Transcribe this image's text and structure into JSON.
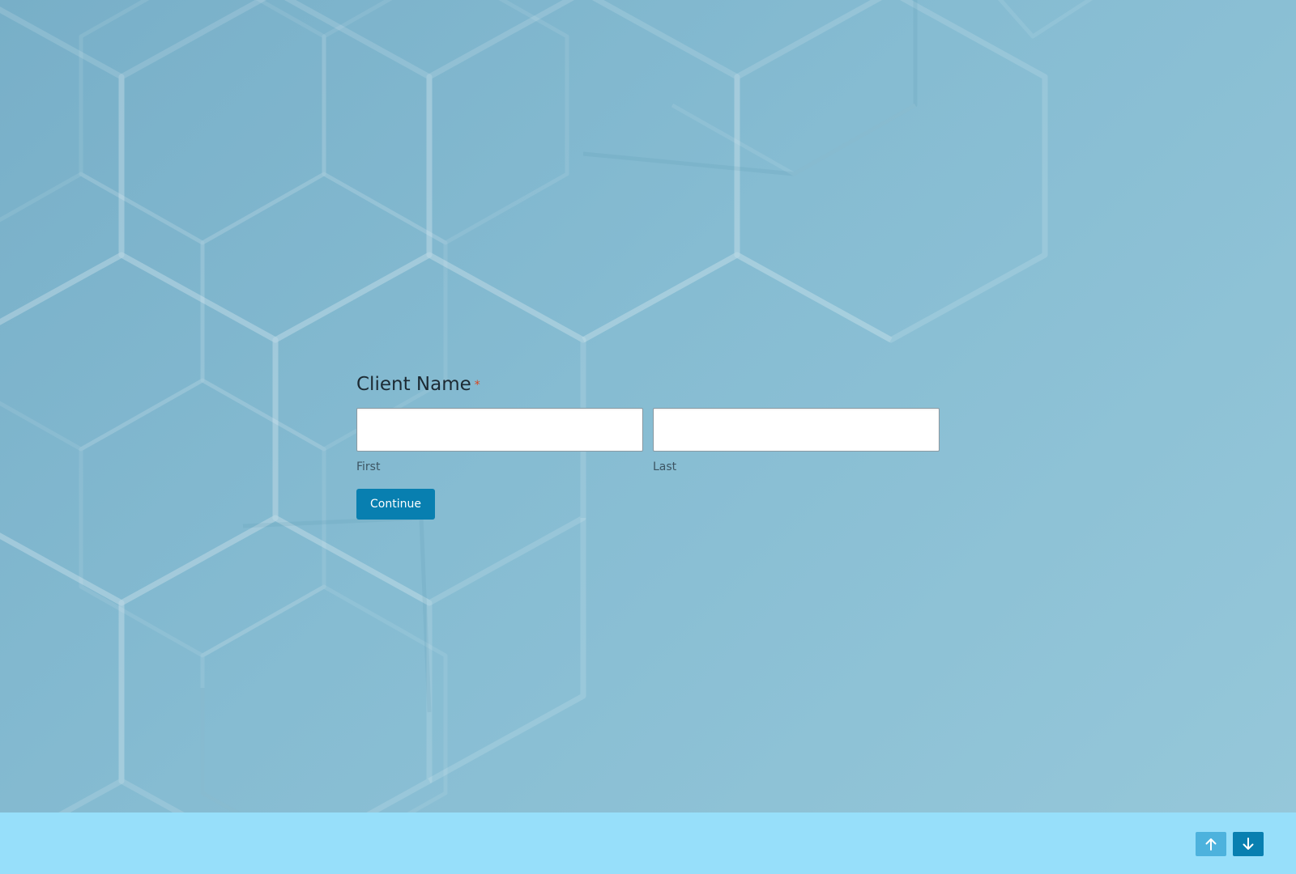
{
  "form": {
    "question_label": "Client Name",
    "required_marker": "*",
    "fields": {
      "first": {
        "value": "",
        "placeholder": "",
        "sublabel": "First"
      },
      "last": {
        "value": "",
        "placeholder": "",
        "sublabel": "Last"
      }
    },
    "continue_label": "Continue"
  },
  "footer": {
    "nav_up_icon": "arrow-up-icon",
    "nav_down_icon": "arrow-down-icon"
  },
  "colors": {
    "background_start": "#78afc8",
    "background_end": "#96c8da",
    "footer": "#97dffa",
    "accent": "#087fb0",
    "nav_up": "#4db2dd",
    "required": "#d9461e"
  }
}
